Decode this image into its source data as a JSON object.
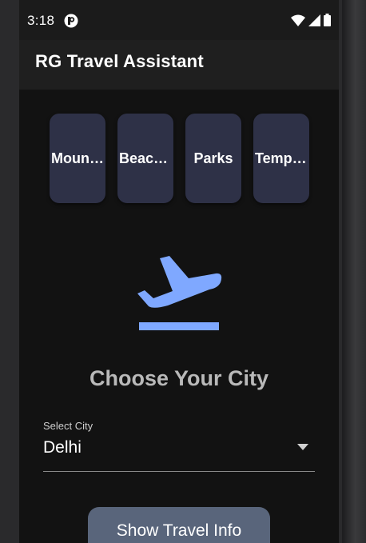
{
  "status_bar": {
    "time": "3:18"
  },
  "app_bar": {
    "title": "RG Travel Assistant"
  },
  "categories": [
    {
      "label": "Mountains"
    },
    {
      "label": "Beaches"
    },
    {
      "label": "Parks"
    },
    {
      "label": "Temples"
    }
  ],
  "hero": {
    "icon": "flight-takeoff-icon",
    "color": "#7fa8ff"
  },
  "heading": "Choose Your City",
  "city_select": {
    "label": "Select City",
    "value": "Delhi"
  },
  "show_button": {
    "label": "Show Travel Info"
  },
  "colors": {
    "background": "#121212",
    "app_bar": "#1f1f1f",
    "card": "#2e3147",
    "button": "#59657b",
    "accent": "#7fa8ff"
  }
}
